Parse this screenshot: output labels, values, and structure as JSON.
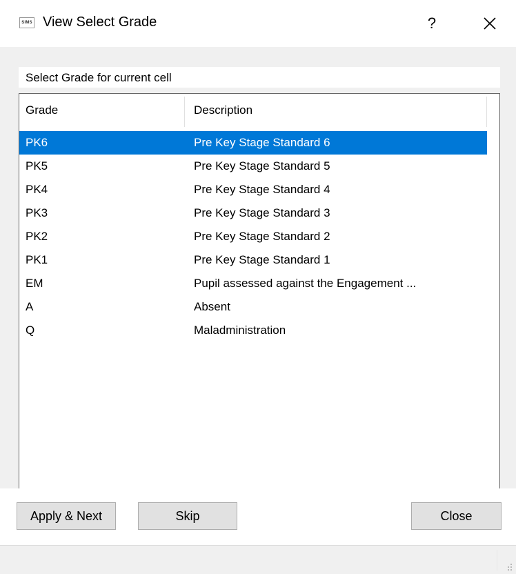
{
  "window": {
    "app_icon_text": "SIMS",
    "title": "View Select Grade",
    "help_label": "?"
  },
  "prompt": {
    "text": "Select Grade for current cell"
  },
  "grade_list": {
    "columns": [
      "Grade",
      "Description"
    ],
    "selected_index": 0,
    "rows": [
      {
        "grade": "PK6",
        "description": "Pre Key Stage Standard 6"
      },
      {
        "grade": "PK5",
        "description": "Pre Key Stage Standard 5"
      },
      {
        "grade": "PK4",
        "description": "Pre Key Stage Standard 4"
      },
      {
        "grade": "PK3",
        "description": "Pre Key Stage Standard 3"
      },
      {
        "grade": "PK2",
        "description": "Pre Key Stage Standard 2"
      },
      {
        "grade": "PK1",
        "description": "Pre Key Stage Standard 1"
      },
      {
        "grade": "EM",
        "description": "Pupil assessed against the Engagement ..."
      },
      {
        "grade": "A",
        "description": "Absent"
      },
      {
        "grade": "Q",
        "description": "Maladministration"
      }
    ]
  },
  "buttons": {
    "apply_next": "Apply & Next",
    "skip": "Skip",
    "close": "Close"
  },
  "colors": {
    "selection": "#0078d7",
    "dialog_background": "#f0f0f0"
  },
  "icons": [
    "sims-app-icon",
    "close-icon",
    "resize-grip-icon"
  ]
}
